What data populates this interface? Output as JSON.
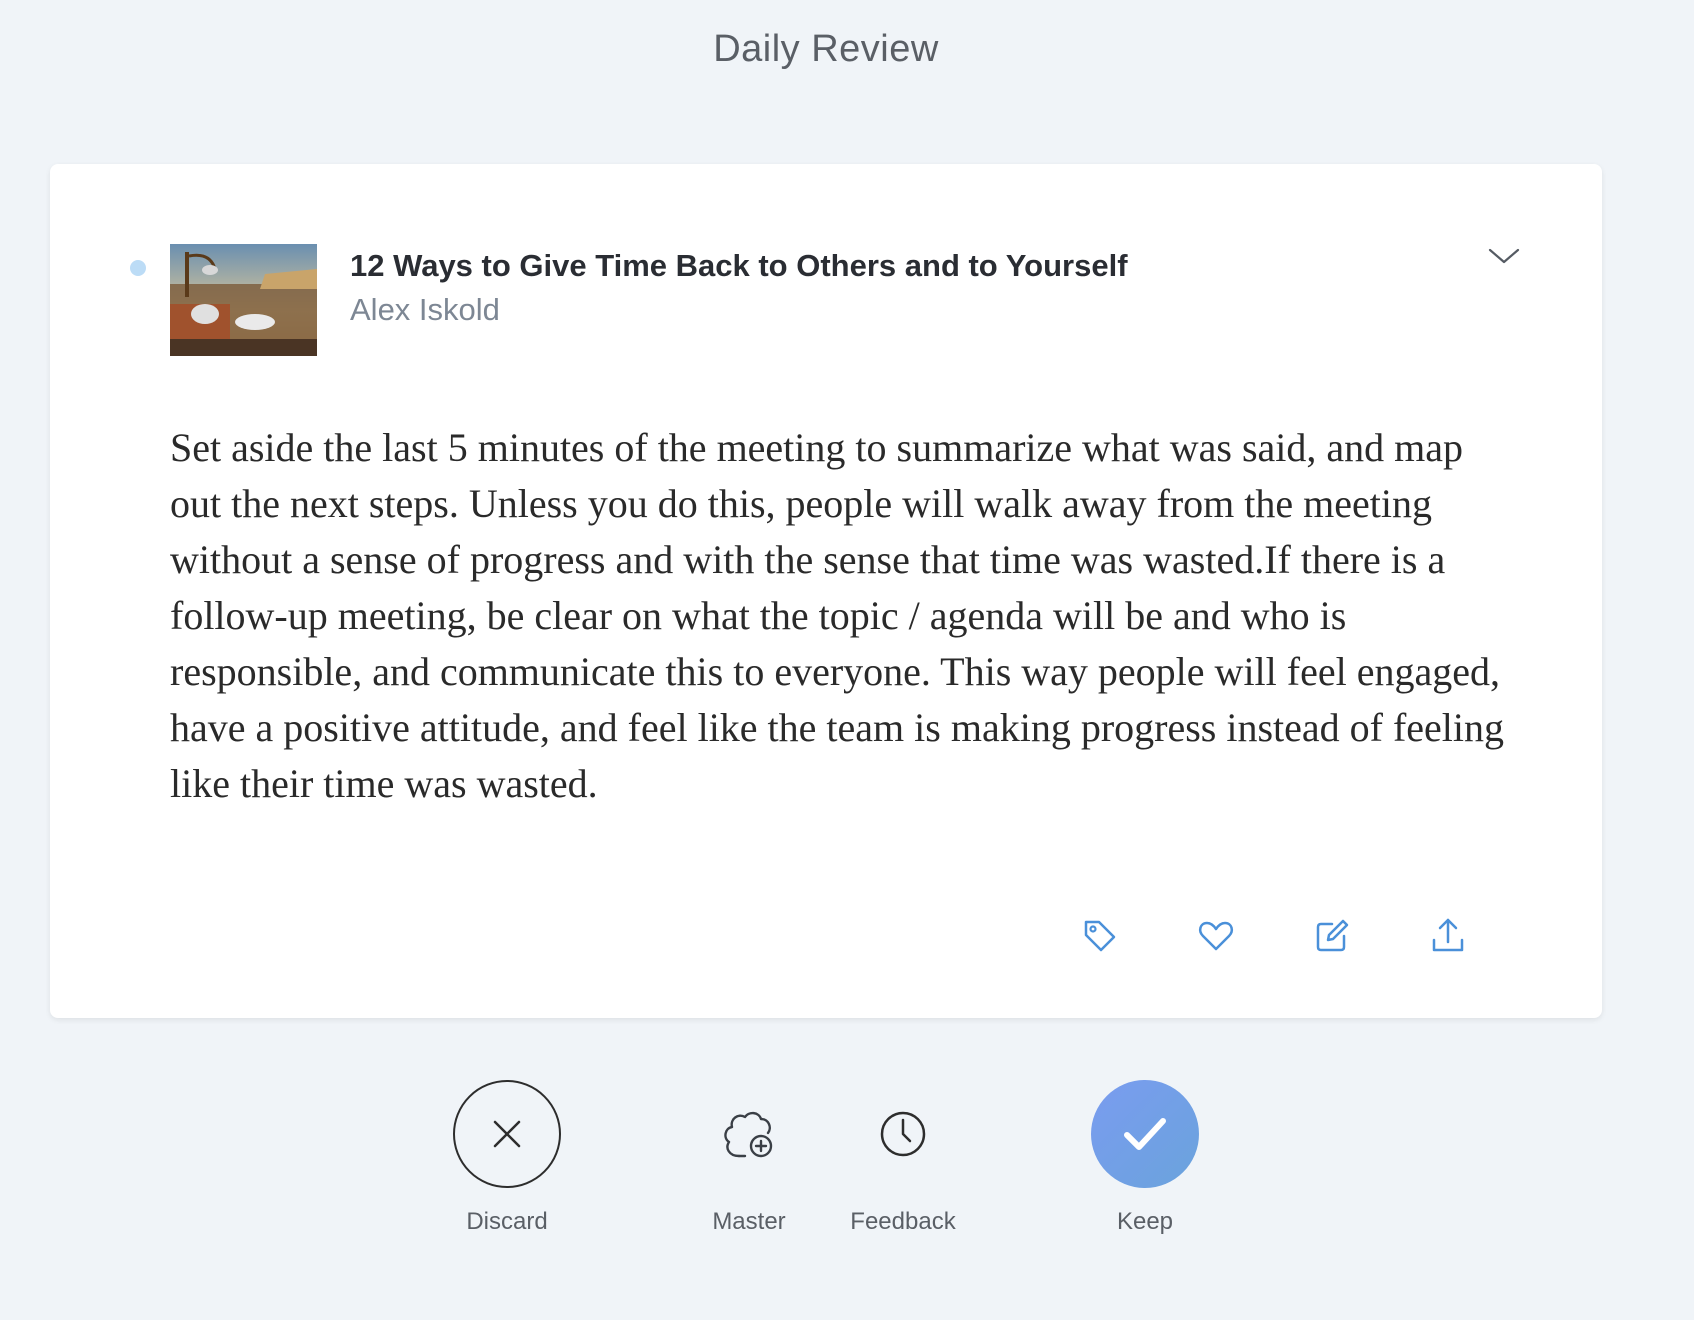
{
  "header": {
    "title": "Daily Review"
  },
  "card": {
    "book_title": "12 Ways to Give Time Back to Others and to Yourself",
    "author": "Alex Iskold",
    "highlight": "Set aside the last 5 minutes of the meeting to summarize what was said, and map out the next steps. Unless you do this, people will walk away from the meeting without a sense of progress and with the sense that time was wasted.If there is a follow-up meeting, be clear on what the topic / agenda will be and who is responsible, and communicate this to everyone. This way people will feel engaged, have a positive attitude, and feel like the team is making progress instead of feeling like their time was wasted.",
    "actions": [
      {
        "icon": "tag-icon"
      },
      {
        "icon": "heart-icon"
      },
      {
        "icon": "edit-icon"
      },
      {
        "icon": "share-icon"
      }
    ],
    "accent_color": "#4a90d9",
    "unread_dot_color": "#bcdcf6"
  },
  "bottom_actions": {
    "discard_label": "Discard",
    "master_label": "Master",
    "feedback_label": "Feedback",
    "keep_label": "Keep",
    "keep_color": "#7a9cf0"
  }
}
